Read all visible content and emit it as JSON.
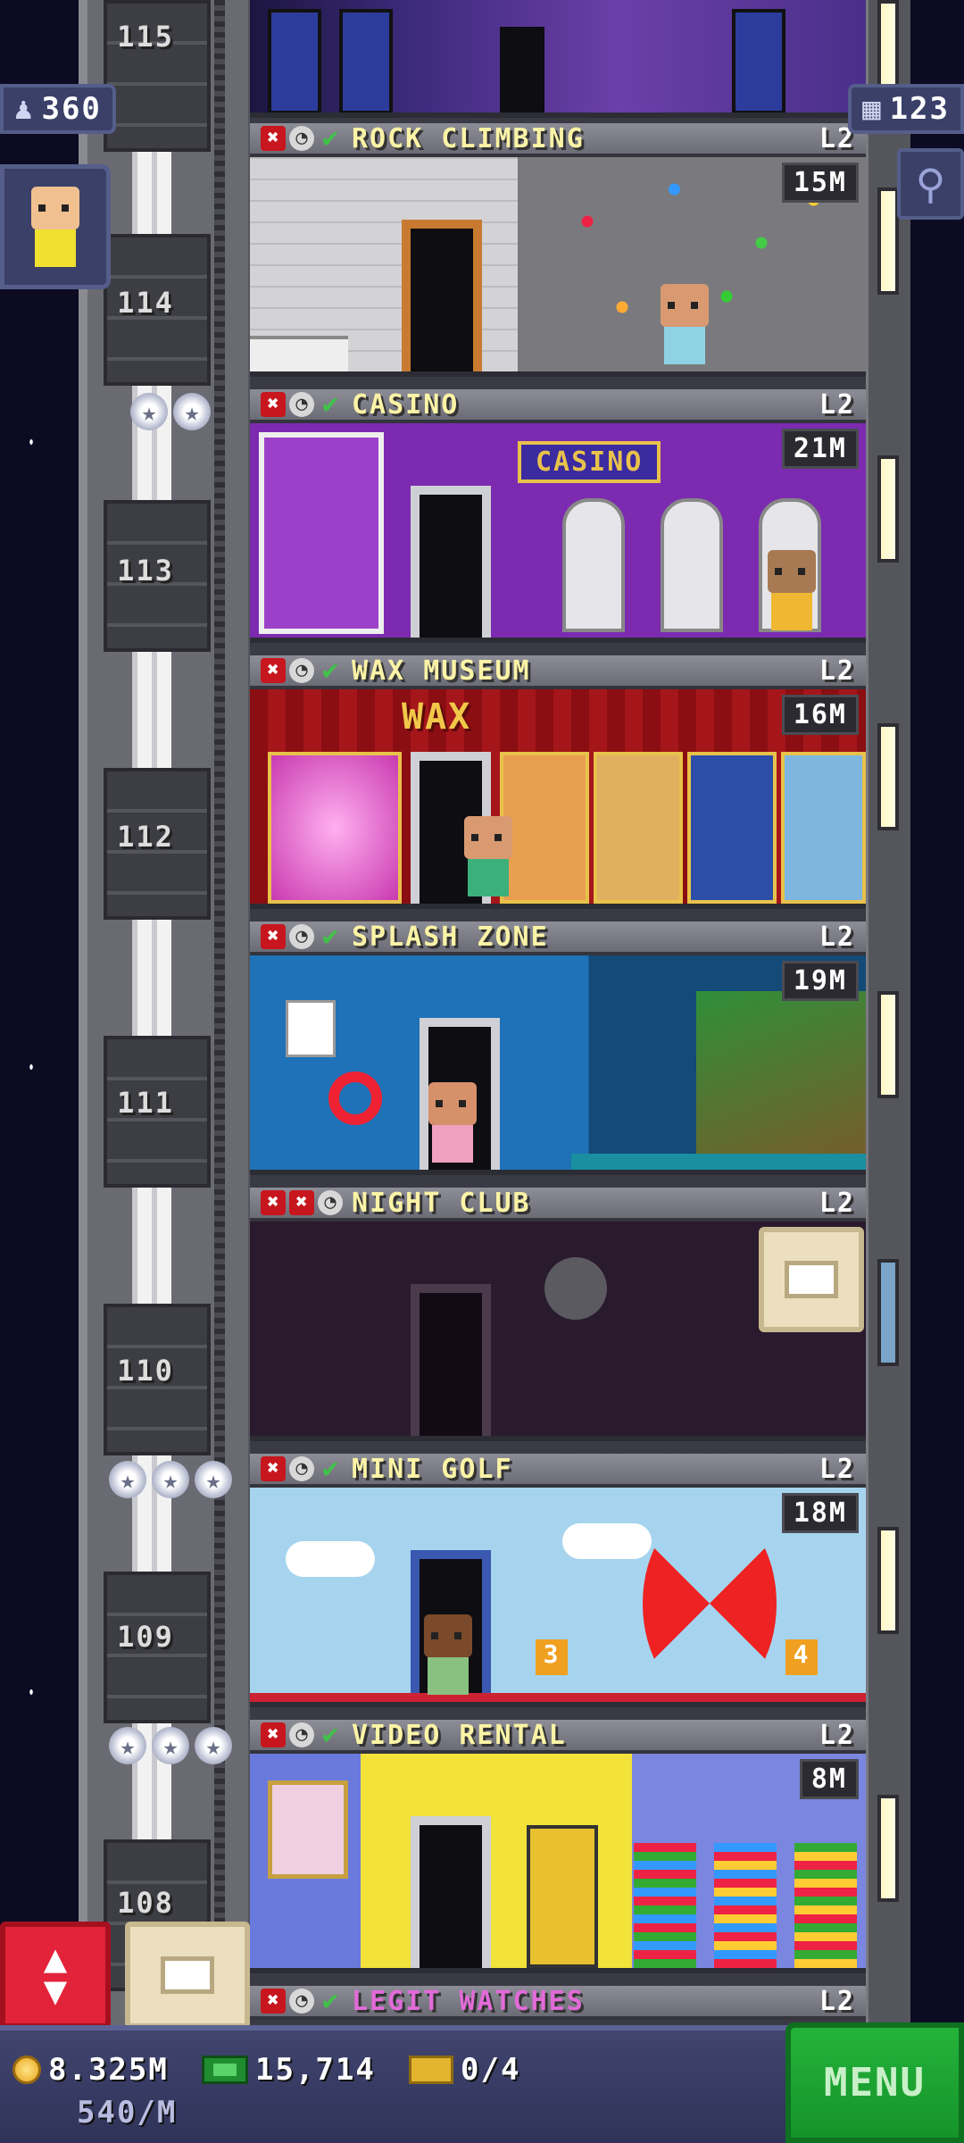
{
  "status": {
    "population": "360",
    "floors_count": "123"
  },
  "shaft": {
    "floor_numbers": [
      "115",
      "114",
      "113",
      "112",
      "111",
      "110",
      "109",
      "108"
    ]
  },
  "floors": [
    {
      "name": "ROCK CLIMBING",
      "level": "L2",
      "earning": "15M"
    },
    {
      "name": "CASINO",
      "level": "L2",
      "earning": "21M",
      "sign": "CASINO"
    },
    {
      "name": "WAX MUSEUM",
      "level": "L2",
      "earning": "16M",
      "sign": "WAX"
    },
    {
      "name": "SPLASH ZONE",
      "level": "L2",
      "earning": "19M"
    },
    {
      "name": "NIGHT CLUB",
      "level": "L2",
      "earning": ""
    },
    {
      "name": "MINI GOLF",
      "level": "L2",
      "earning": "18M",
      "hole_left": "3",
      "hole_right": "4"
    },
    {
      "name": "VIDEO RENTAL",
      "level": "L2",
      "earning": "8M"
    },
    {
      "name": "LEGIT WATCHES",
      "level": "L2",
      "earning": ""
    }
  ],
  "bottom": {
    "coins": "8.325M",
    "coin_rate": "540/M",
    "bux": "15,714",
    "tickets": "0/4",
    "menu_label": "MENU"
  },
  "colors": {
    "floor_name": "#fbf3a6",
    "legit_watches_name": "#e26bd8",
    "menu": "#1fa534"
  },
  "icons": {
    "population": "person-icon",
    "floors": "building-icon",
    "search": "magnifier-icon",
    "elevator": "up-down-arrows-icon",
    "stock": "box-icon"
  }
}
